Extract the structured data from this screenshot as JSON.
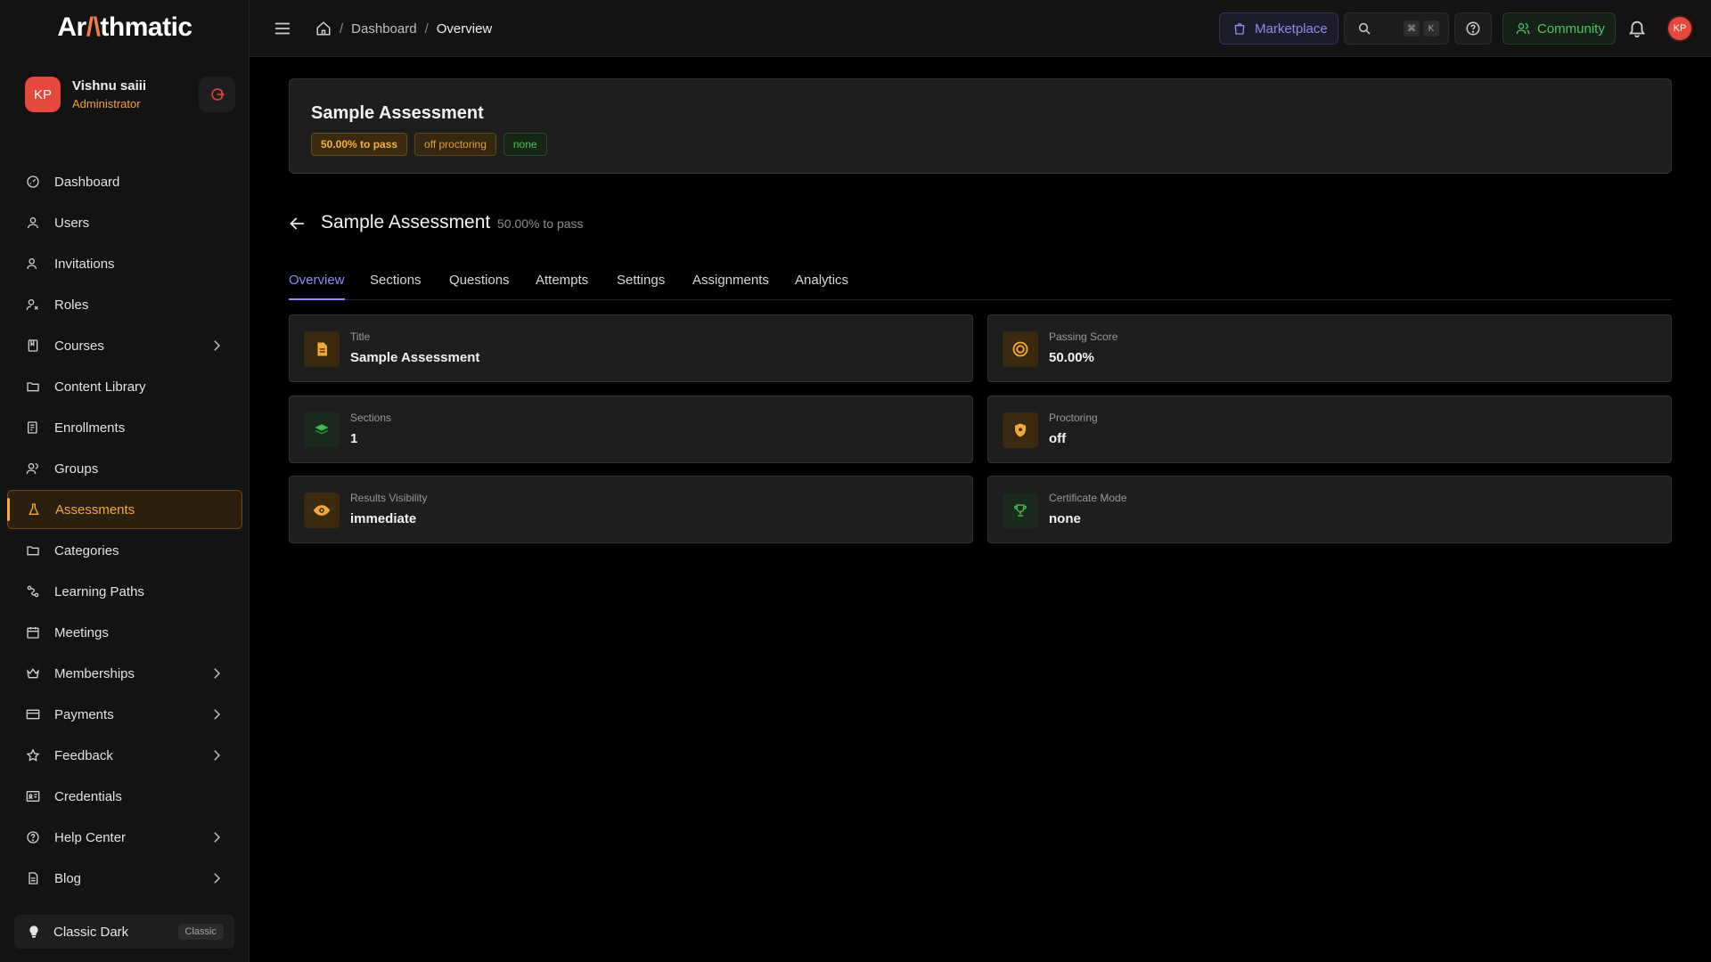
{
  "app": {
    "logo_text_a": "Ar",
    "logo_accent": "/\\",
    "logo_text_b": "thmatic"
  },
  "user": {
    "initials": "KP",
    "name": "Vishnu saiii",
    "role": "Administrator"
  },
  "sidebar": {
    "items": [
      {
        "label": "Dashboard",
        "icon": "dashboard-icon",
        "has_children": false
      },
      {
        "label": "Users",
        "icon": "user-icon",
        "has_children": false
      },
      {
        "label": "Invitations",
        "icon": "user-plus-icon",
        "has_children": false
      },
      {
        "label": "Roles",
        "icon": "roles-icon",
        "has_children": false
      },
      {
        "label": "Courses",
        "icon": "book-icon",
        "has_children": true
      },
      {
        "label": "Content Library",
        "icon": "folder-icon",
        "has_children": false
      },
      {
        "label": "Enrollments",
        "icon": "enroll-icon",
        "has_children": false
      },
      {
        "label": "Groups",
        "icon": "group-icon",
        "has_children": false
      },
      {
        "label": "Assessments",
        "icon": "flask-icon",
        "has_children": false,
        "active": true
      },
      {
        "label": "Categories",
        "icon": "folder-icon",
        "has_children": false
      },
      {
        "label": "Learning Paths",
        "icon": "route-icon",
        "has_children": false
      },
      {
        "label": "Meetings",
        "icon": "calendar-icon",
        "has_children": false
      },
      {
        "label": "Memberships",
        "icon": "crown-icon",
        "has_children": true
      },
      {
        "label": "Payments",
        "icon": "card-icon",
        "has_children": true
      },
      {
        "label": "Feedback",
        "icon": "star-icon",
        "has_children": true
      },
      {
        "label": "Credentials",
        "icon": "id-card-icon",
        "has_children": false
      },
      {
        "label": "Help Center",
        "icon": "help-icon",
        "has_children": true
      },
      {
        "label": "Blog",
        "icon": "doc-icon",
        "has_children": true
      }
    ],
    "theme": {
      "label": "Classic Dark",
      "badge": "Classic"
    }
  },
  "topbar": {
    "breadcrumbs": [
      "Dashboard",
      "Overview"
    ],
    "marketplace_label": "Marketplace",
    "search_kbd": [
      "⌘",
      "K"
    ],
    "community_label": "Community",
    "avatar_initials": "KP"
  },
  "assessment": {
    "title": "Sample Assessment",
    "chips": [
      "50.00% to pass",
      "off proctoring",
      "none"
    ],
    "detail_title": "Sample Assessment",
    "detail_sub": "50.00% to pass"
  },
  "tabs": [
    "Overview",
    "Sections",
    "Questions",
    "Attempts",
    "Settings",
    "Assignments",
    "Analytics"
  ],
  "cards": [
    {
      "label": "Title",
      "value": "Sample Assessment",
      "icon": "document-icon"
    },
    {
      "label": "Passing Score",
      "value": "50.00%",
      "icon": "target-icon"
    },
    {
      "label": "Sections",
      "value": "1",
      "icon": "layers-icon"
    },
    {
      "label": "Proctoring",
      "value": "off",
      "icon": "shield-icon"
    },
    {
      "label": "Results Visibility",
      "value": "immediate",
      "icon": "eye-icon"
    },
    {
      "label": "Certificate Mode",
      "value": "none",
      "icon": "trophy-icon"
    }
  ],
  "colors": {
    "accent_amber": "#f5a83a",
    "accent_purple": "#8e8cf5",
    "accent_green": "#4bc765",
    "avatar_red": "#e5483c"
  }
}
